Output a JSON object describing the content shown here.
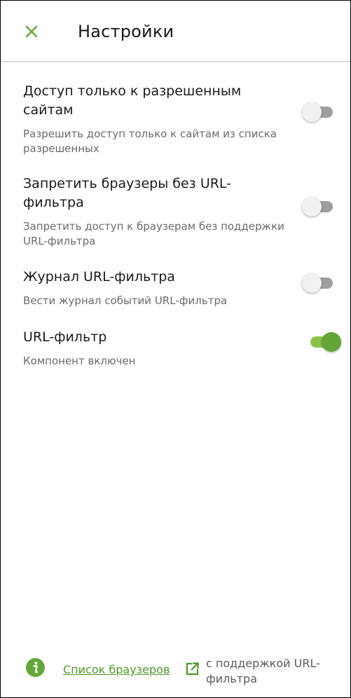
{
  "header": {
    "title": "Настройки",
    "close_icon": "close-icon"
  },
  "settings": [
    {
      "title": "Доступ только к разрешенным сайтам",
      "description": "Разрешить доступ только к сайтам из списка разрешенных",
      "enabled": false
    },
    {
      "title": "Запретить браузеры без URL-фильтра",
      "description": "Запретить доступ к браузерам без поддержки URL-фильтра",
      "enabled": false
    },
    {
      "title": "Журнал URL-фильтра",
      "description": "Вести журнал событий URL-фильтра",
      "enabled": false
    },
    {
      "title": "URL-фильтр",
      "description": "Компонент включен",
      "enabled": true
    }
  ],
  "footer": {
    "link_text": "Список браузеров",
    "note": "с поддержкой URL-фильтра",
    "info_icon": "info-icon",
    "external_icon": "external-link-icon"
  },
  "colors": {
    "accent": "#63a637",
    "link": "#4c9a2a"
  }
}
